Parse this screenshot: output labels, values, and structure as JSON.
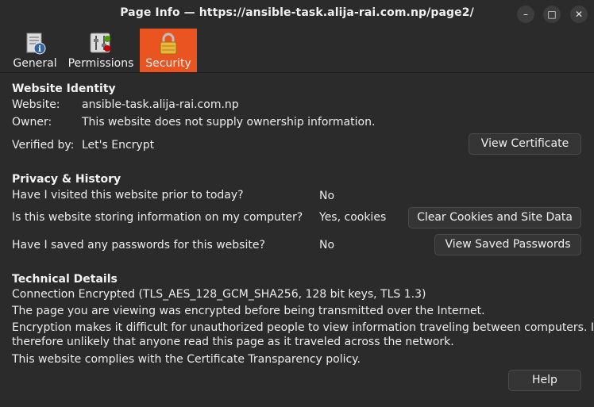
{
  "window": {
    "title": "Page Info — https://ansible-task.alija-rai.com.np/page2/",
    "minimize_glyph": "–",
    "maximize_glyph": "□",
    "close_glyph": "✕"
  },
  "tabs": [
    {
      "label": "General",
      "icon": "info-page-icon",
      "active": false
    },
    {
      "label": "Permissions",
      "icon": "permissions-sliders-icon",
      "active": false
    },
    {
      "label": "Security",
      "icon": "padlock-icon",
      "active": true
    }
  ],
  "identity": {
    "heading": "Website Identity",
    "website_label": "Website:",
    "website_value": "ansible-task.alija-rai.com.np",
    "owner_label": "Owner:",
    "owner_value": "This website does not supply ownership information.",
    "verified_label": "Verified by:",
    "verified_value": "Let's Encrypt",
    "view_certificate": "View Certificate"
  },
  "privacy": {
    "heading": "Privacy & History",
    "q1": "Have I visited this website prior to today?",
    "a1": "No",
    "q2": "Is this website storing information on my computer?",
    "a2": "Yes, cookies",
    "clear_button": "Clear Cookies and Site Data",
    "q3": "Have I saved any passwords for this website?",
    "a3": "No",
    "passwords_button": "View Saved Passwords"
  },
  "technical": {
    "heading": "Technical Details",
    "line1": "Connection Encrypted (TLS_AES_128_GCM_SHA256, 128 bit keys, TLS 1.3)",
    "line2": "The page you are viewing was encrypted before being transmitted over the Internet.",
    "line3a": "Encryption makes it difficult for unauthorized people to view information traveling between computers. It is",
    "line3b": "therefore unlikely that anyone read this page as it traveled across the network.",
    "line4": "This website complies with the Certificate Transparency policy."
  },
  "help_button": "Help",
  "colors": {
    "accent": "#e95420",
    "background": "#2b2b2b"
  }
}
